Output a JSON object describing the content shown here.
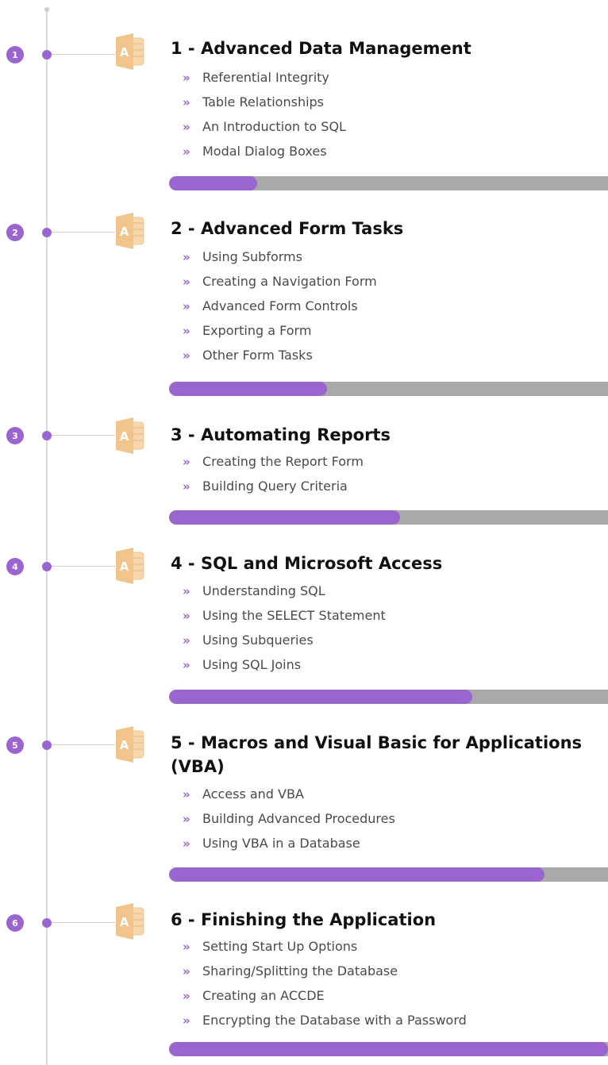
{
  "colors": {
    "accent": "#9b65cf",
    "track": "#a9a9a9",
    "icon_orange": "#f0c48a",
    "icon_text": "#ffffff"
  },
  "icon_name": "access-app-icon",
  "icon_letter": "A",
  "modules": [
    {
      "number": "1",
      "title": "1 - Advanced Data Management",
      "topics": [
        "Referential Integrity",
        "Table Relationships",
        "An Introduction to SQL",
        "Modal Dialog Boxes"
      ],
      "progress": 0.2
    },
    {
      "number": "2",
      "title": "2 - Advanced Form Tasks",
      "topics": [
        "Using Subforms",
        "Creating a Navigation Form",
        "Advanced Form Controls",
        "Exporting a Form",
        "Other Form Tasks"
      ],
      "progress": 0.36
    },
    {
      "number": "3",
      "title": "3 - Automating Reports",
      "topics": [
        "Creating the Report Form",
        "Building Query Criteria"
      ],
      "progress": 0.527
    },
    {
      "number": "4",
      "title": "4 - SQL and Microsoft Access",
      "topics": [
        "Understanding SQL",
        "Using the SELECT Statement",
        "Using Subqueries",
        "Using SQL Joins"
      ],
      "progress": 0.69
    },
    {
      "number": "5",
      "title": "5 - Macros and Visual Basic for Applications (VBA)",
      "topics": [
        "Access and VBA",
        "Building Advanced Procedures",
        "Using VBA in a Database"
      ],
      "progress": 0.855
    },
    {
      "number": "6",
      "title": "6 - Finishing the Application",
      "topics": [
        "Setting Start Up Options",
        "Sharing/Splitting the Database",
        "Creating an ACCDE",
        "Encrypting the Database with a Password"
      ],
      "progress": 1.0
    }
  ]
}
